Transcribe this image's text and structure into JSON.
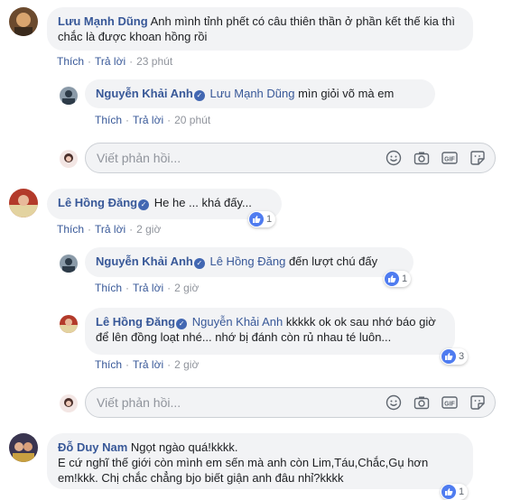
{
  "actions": {
    "like": "Thích",
    "reply": "Trả lời",
    "sep": "·"
  },
  "reply_placeholder": "Viết phản hồi...",
  "comments": [
    {
      "author": "Lưu Mạnh Dũng",
      "text": "Anh mình tỉnh phết có câu thiên thần ở phần kết thế kia thì chắc là được khoan hồng rồi",
      "time": "23 phút"
    },
    {
      "author": "Nguyễn Khải Anh",
      "mention": "Lưu Mạnh Dũng",
      "text": "mìn giỏi võ mà em",
      "time": "20 phút"
    },
    {
      "author": "Lê Hồng Đăng",
      "text": "He he ... khá đấy...",
      "time": "2 giờ",
      "reactions": "1"
    },
    {
      "author": "Nguyễn Khải Anh",
      "mention": "Lê Hồng Đăng",
      "text": "đến lượt chú đấy",
      "time": "2 giờ",
      "reactions": "1"
    },
    {
      "author": "Lê Hồng Đăng",
      "mention": "Nguyễn Khải Anh",
      "text": "kkkkk ok ok sau nhớ báo giờ để lên đồng loạt nhé... nhớ bị đánh còn rủ nhau té luôn...",
      "time": "2 giờ",
      "reactions": "3"
    },
    {
      "author": "Đỗ Duy Nam",
      "text_line1": "Ngọt ngào quá!kkkk.",
      "text_line2": "E cứ nghĩ thế giới còn mình em sến mà anh còn Lim,Táu,Chắc,Gụ hơn em!kkk. Chị chắc chẳng bjo biết giận anh đâu nhỉ?kkkk",
      "reactions": "1"
    }
  ],
  "colors": {
    "link": "#385898",
    "bubble": "#f2f3f5",
    "like_blue": "#4f7cf0"
  },
  "icons": [
    "smiley-icon",
    "camera-icon",
    "gif-icon",
    "sticker-icon",
    "like-reaction-icon",
    "verified-badge-icon"
  ]
}
